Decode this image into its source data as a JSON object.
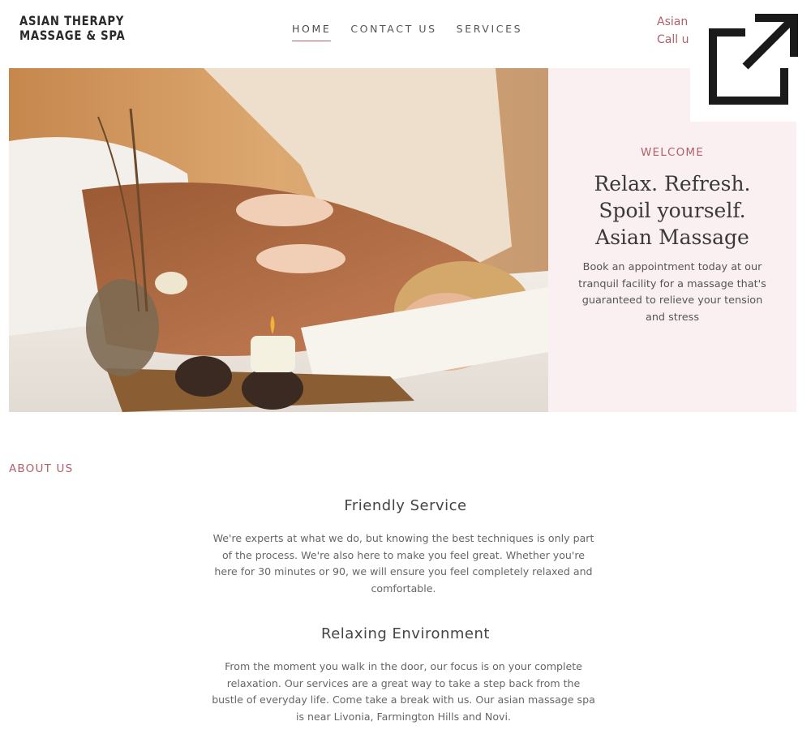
{
  "header": {
    "logo_line1": "ASIAN THERAPY",
    "logo_line2": "MASSAGE & SPA",
    "nav": [
      {
        "label": "HOME",
        "active": true
      },
      {
        "label": "CONTACT US",
        "active": false
      },
      {
        "label": "SERVICES",
        "active": false
      }
    ],
    "info_line1": "Asian",
    "info_line2": "Call u"
  },
  "hero": {
    "eyebrow": "WELCOME",
    "title_line1": "Relax. Refresh.",
    "title_line2": "Spoil yourself.",
    "title_line3": "Asian Massage",
    "text": "Book an appointment today at our tranquil facility for a massage that's guaranteed to relieve your tension and stress",
    "image_icon": "massage-photo"
  },
  "about": {
    "label": "ABOUT US",
    "sections": [
      {
        "title": "Friendly Service",
        "text": "We're experts at what we do, but knowing the best techniques is only part of the process. We're also here to make you feel great. Whether you're here for 30 minutes or 90, we will ensure you feel completely relaxed and comfortable."
      },
      {
        "title": "Relaxing Environment",
        "text": "From the moment you walk in the door, our focus is on your complete relaxation. Our services are a great way to take a step back from the bustle of everyday life. Come take a break with us. Our asian massage spa is near Livonia, Farmington Hills and Novi."
      }
    ]
  },
  "overlay": {
    "icon": "external-link-icon"
  },
  "colors": {
    "accent": "#b0606a",
    "panel": "#fbf0f1",
    "text": "#555555"
  }
}
